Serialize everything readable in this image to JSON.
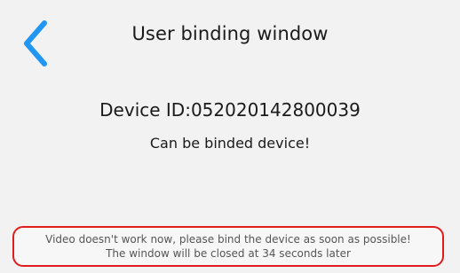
{
  "header": {
    "title": "User binding window",
    "back_icon": "chevron-left-icon",
    "accent_color": "#2196f3"
  },
  "main": {
    "device_id": "Device ID:052020142800039",
    "status": "Can be binded device!"
  },
  "notice": {
    "line1": "Video doesn't work now, please bind the device as soon as possible!",
    "line2": "The window will be closed at 34 seconds later",
    "border_color": "#e01c1c"
  }
}
